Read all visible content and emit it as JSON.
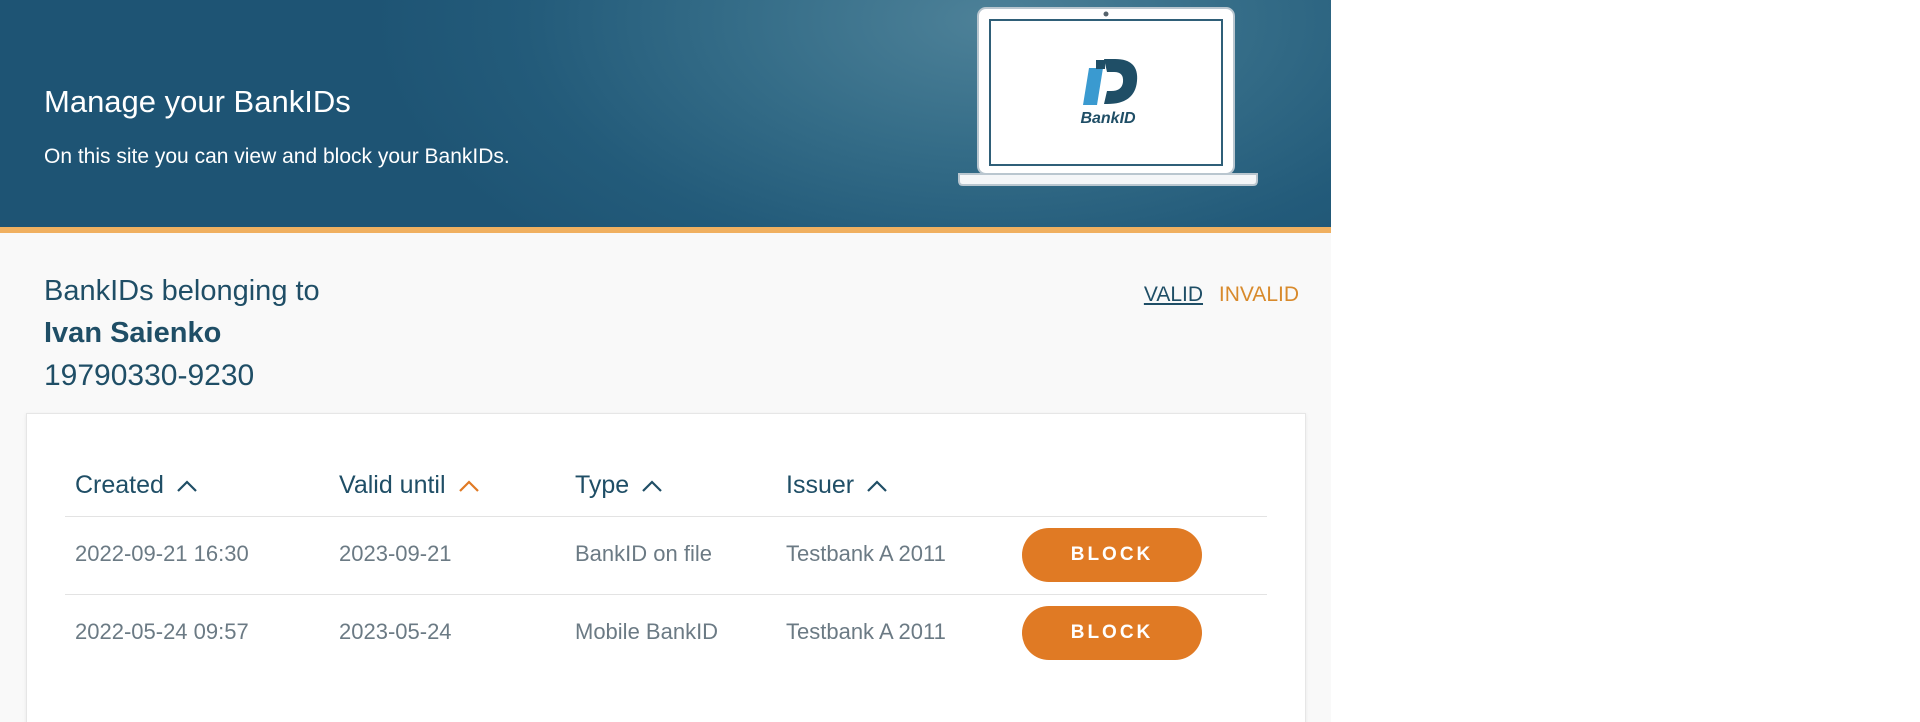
{
  "hero": {
    "title": "Manage your BankIDs",
    "subtitle": "On this site you can view and block your BankIDs.",
    "logo_text": "BankID"
  },
  "owner": {
    "heading": "BankIDs belonging to",
    "name": "Ivan Saienko",
    "personal_number": "19790330-9230"
  },
  "filters": {
    "valid_label": "VALID",
    "invalid_label": "INVALID",
    "active": "VALID"
  },
  "table": {
    "columns": [
      "Created",
      "Valid until",
      "Type",
      "Issuer"
    ],
    "sorted_column": "Valid until",
    "rows": [
      {
        "created": "2022-09-21 16:30",
        "valid_until": "2023-09-21",
        "type": "BankID on file",
        "issuer": "Testbank A 2011",
        "action": "BLOCK"
      },
      {
        "created": "2022-05-24 09:57",
        "valid_until": "2023-05-24",
        "type": "Mobile BankID",
        "issuer": "Testbank A 2011",
        "action": "BLOCK"
      }
    ]
  },
  "colors": {
    "brand_dark": "#1f4e66",
    "accent_orange": "#e07a24",
    "highlight_orange": "#f0b060",
    "hero_blue": "#235b7a"
  },
  "icons": {
    "sort": "chevron-up-icon",
    "logo": "bankid-logo"
  }
}
